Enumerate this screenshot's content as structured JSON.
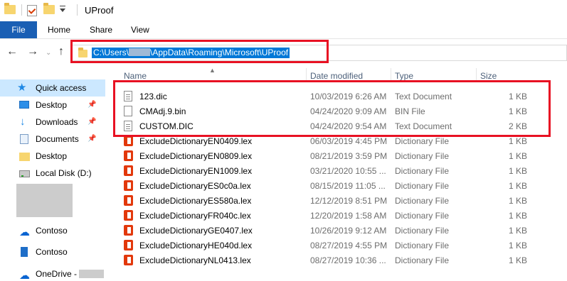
{
  "window": {
    "title": "UProof"
  },
  "ribbon": {
    "tabs": [
      "File",
      "Home",
      "Share",
      "View"
    ]
  },
  "address": {
    "path_prefix": "C:\\Users\\",
    "path_suffix": "\\AppData\\Roaming\\Microsoft\\UProof"
  },
  "sidebar": {
    "items": [
      {
        "label": "Quick access",
        "icon": "star-icon",
        "pinned": false
      },
      {
        "label": "Desktop",
        "icon": "desktop-icon",
        "pinned": true
      },
      {
        "label": "Downloads",
        "icon": "download-icon",
        "pinned": true
      },
      {
        "label": "Documents",
        "icon": "document-icon",
        "pinned": true
      },
      {
        "label": "Desktop",
        "icon": "folder-icon",
        "pinned": false
      },
      {
        "label": "Local Disk (D:)",
        "icon": "disk-icon",
        "pinned": false
      },
      {
        "label": "Contoso",
        "icon": "cloud-icon",
        "pinned": false
      },
      {
        "label": "Contoso",
        "icon": "building-icon",
        "pinned": false
      },
      {
        "label": "OneDrive -",
        "icon": "onedrive-icon",
        "pinned": false
      }
    ]
  },
  "columns": {
    "name": "Name",
    "date": "Date modified",
    "type": "Type",
    "size": "Size"
  },
  "files": [
    {
      "name": "123.dic",
      "date": "10/03/2019 6:26 AM",
      "type": "Text Document",
      "size": "1 KB",
      "icon": "text-doc-icon"
    },
    {
      "name": "CMAdj.9.bin",
      "date": "04/24/2020 9:09 AM",
      "type": "BIN File",
      "size": "1 KB",
      "icon": "bin-file-icon"
    },
    {
      "name": "CUSTOM.DIC",
      "date": "04/24/2020 9:54 AM",
      "type": "Text Document",
      "size": "2 KB",
      "icon": "text-doc-icon"
    },
    {
      "name": "ExcludeDictionaryEN0409.lex",
      "date": "06/03/2019 4:45 PM",
      "type": "Dictionary File",
      "size": "1 KB",
      "icon": "office-icon"
    },
    {
      "name": "ExcludeDictionaryEN0809.lex",
      "date": "08/21/2019 3:59 PM",
      "type": "Dictionary File",
      "size": "1 KB",
      "icon": "office-icon"
    },
    {
      "name": "ExcludeDictionaryEN1009.lex",
      "date": "03/21/2020 10:55 ...",
      "type": "Dictionary File",
      "size": "1 KB",
      "icon": "office-icon"
    },
    {
      "name": "ExcludeDictionaryES0c0a.lex",
      "date": "08/15/2019 11:05 ...",
      "type": "Dictionary File",
      "size": "1 KB",
      "icon": "office-icon"
    },
    {
      "name": "ExcludeDictionaryES580a.lex",
      "date": "12/12/2019 8:51 PM",
      "type": "Dictionary File",
      "size": "1 KB",
      "icon": "office-icon"
    },
    {
      "name": "ExcludeDictionaryFR040c.lex",
      "date": "12/20/2019 1:58 AM",
      "type": "Dictionary File",
      "size": "1 KB",
      "icon": "office-icon"
    },
    {
      "name": "ExcludeDictionaryGE0407.lex",
      "date": "10/26/2019 9:12 AM",
      "type": "Dictionary File",
      "size": "1 KB",
      "icon": "office-icon"
    },
    {
      "name": "ExcludeDictionaryHE040d.lex",
      "date": "08/27/2019 4:55 PM",
      "type": "Dictionary File",
      "size": "1 KB",
      "icon": "office-icon"
    },
    {
      "name": "ExcludeDictionaryNL0413.lex",
      "date": "08/27/2019 10:36 ...",
      "type": "Dictionary File",
      "size": "1 KB",
      "icon": "office-icon"
    }
  ],
  "annotations": {
    "highlight_color": "#e81123"
  },
  "colors": {
    "file_tab": "#1a5fb4",
    "selection": "#cce8ff",
    "address_highlight": "#0078d7"
  }
}
